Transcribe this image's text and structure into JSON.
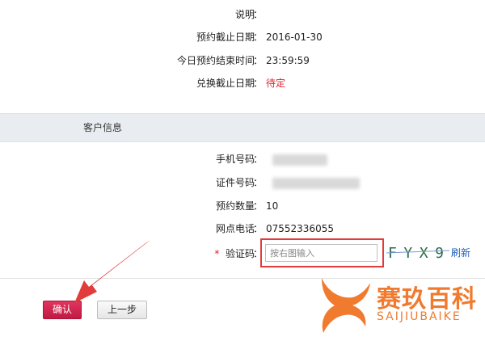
{
  "colors": {
    "accent_red": "#e0202a",
    "confirm_button": "#c01a44",
    "link_blue": "#1f5fb8",
    "watermark_orange": "#f07a2e"
  },
  "top_fields": [
    {
      "label": "说明",
      "colon": "：",
      "value": ""
    },
    {
      "label": "预约截止日期",
      "colon": "：",
      "value": "2016-01-30"
    },
    {
      "label": "今日预约结束时间",
      "colon": "：",
      "value": "23:59:59"
    },
    {
      "label": "兑换截止日期",
      "colon": "：",
      "value": "待定"
    }
  ],
  "section": {
    "title": "客户信息"
  },
  "customer_fields": [
    {
      "label": "手机号码",
      "colon": "："
    },
    {
      "label": "证件号码",
      "colon": "："
    },
    {
      "label": "预约数量",
      "colon": "：",
      "value": "10"
    },
    {
      "label": "网点电话",
      "colon": "：",
      "value": "07552336055"
    }
  ],
  "captcha": {
    "required_mark": "*",
    "label": "验证码",
    "colon": "：",
    "placeholder": "按右图输入",
    "image_text": "FYX9",
    "refresh_label": "刷新"
  },
  "buttons": {
    "confirm": "确认",
    "back": "上一步"
  },
  "watermark": {
    "cn": "赛玖百科",
    "en": "SAIJIUBAIKE"
  }
}
